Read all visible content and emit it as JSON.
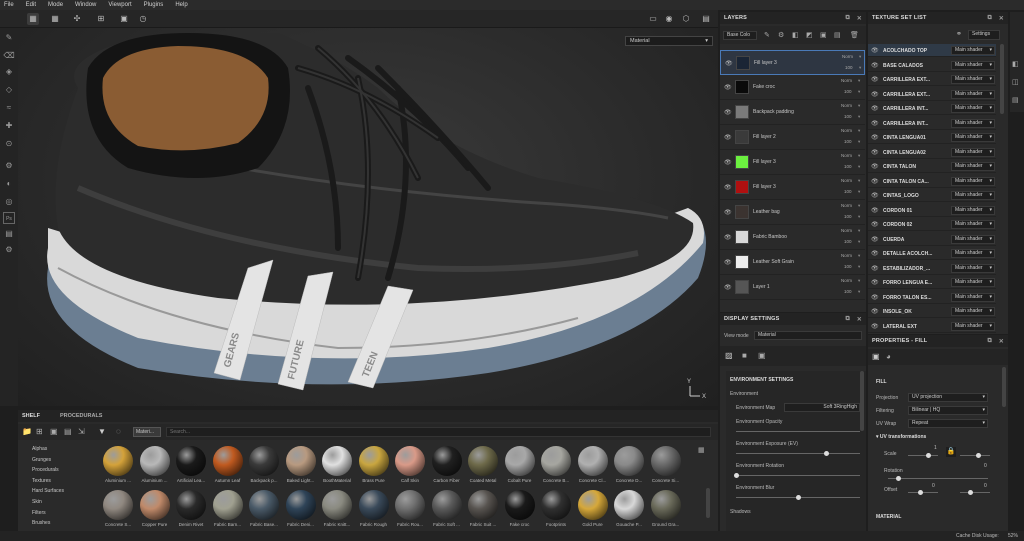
{
  "menu": [
    "File",
    "Edit",
    "Mode",
    "Window",
    "Viewport",
    "Plugins",
    "Help"
  ],
  "viewport": {
    "mode_select": "Material",
    "tag_texts": [
      "GEARS",
      "FUTURE",
      "TEEN"
    ]
  },
  "layers": {
    "title": "LAYERS",
    "channel": "Base Colo",
    "rows": [
      {
        "name": "Fill layer 3",
        "blend": "Norm",
        "opacity": "100",
        "thumb": "#1a2535"
      },
      {
        "name": "Fake croc",
        "blend": "Norm",
        "opacity": "100",
        "thumb": "#0a0a0a"
      },
      {
        "name": "Backpack padding",
        "blend": "Norm",
        "opacity": "100",
        "thumb": "#7a7a7a"
      },
      {
        "name": "Fill layer 2",
        "blend": "Norm",
        "opacity": "100",
        "thumb": "#3a3a3a"
      },
      {
        "name": "Fill layer 3",
        "blend": "Norm",
        "opacity": "100",
        "thumb": "#6cf040"
      },
      {
        "name": "Fill layer 3",
        "blend": "Norm",
        "opacity": "100",
        "thumb": "#b01010"
      },
      {
        "name": "Leather bag",
        "blend": "Norm",
        "opacity": "100",
        "thumb": "#3b3330"
      },
      {
        "name": "Fabric Bamboo",
        "blend": "Norm",
        "opacity": "100",
        "thumb": "#d8d8d8"
      },
      {
        "name": "Leather Soft Grain",
        "blend": "Norm",
        "opacity": "100",
        "thumb": "#eeeeee"
      },
      {
        "name": "Layer 1",
        "blend": "Norm",
        "opacity": "100",
        "thumb": "#555555"
      }
    ]
  },
  "texture_sets": {
    "title": "TEXTURE SET LIST",
    "settings_label": "Settings",
    "rows": [
      {
        "name": "ACOLCHADO TOP",
        "shader": "Main shader"
      },
      {
        "name": "BASE CALADOS",
        "shader": "Main shader"
      },
      {
        "name": "CARRILLERA EXT...",
        "shader": "Main shader"
      },
      {
        "name": "CARRILLERA EXT...",
        "shader": "Main shader"
      },
      {
        "name": "CARRILLERA INT...",
        "shader": "Main shader"
      },
      {
        "name": "CARRILLERA INT...",
        "shader": "Main shader"
      },
      {
        "name": "CINTA LENGUA01",
        "shader": "Main shader"
      },
      {
        "name": "CINTA LENGUA02",
        "shader": "Main shader"
      },
      {
        "name": "CINTA TALON",
        "shader": "Main shader"
      },
      {
        "name": "CINTA TALON CA...",
        "shader": "Main shader"
      },
      {
        "name": "CINTAS_LOGO",
        "shader": "Main shader"
      },
      {
        "name": "CORDON 01",
        "shader": "Main shader"
      },
      {
        "name": "CORDON 02",
        "shader": "Main shader"
      },
      {
        "name": "CUERDA",
        "shader": "Main shader"
      },
      {
        "name": "DETALLE ACOLCH...",
        "shader": "Main shader"
      },
      {
        "name": "ESTABILIZADOR_...",
        "shader": "Main shader"
      },
      {
        "name": "FORRO LENGUA E...",
        "shader": "Main shader"
      },
      {
        "name": "FORRO TALON ES...",
        "shader": "Main shader"
      },
      {
        "name": "INSOLE_OK",
        "shader": "Main shader"
      },
      {
        "name": "LATERAL EXT",
        "shader": "Main shader"
      }
    ]
  },
  "display_settings": {
    "title": "DISPLAY SETTINGS",
    "view_mode_label": "View mode",
    "view_mode": "Material",
    "env_header": "ENVIRONMENT SETTINGS",
    "environment_label": "Environment",
    "env_map_label": "Environment Map",
    "env_map_value": "Soft 3RingHigh",
    "opacity_label": "Environment Opacity",
    "exposure_label": "Environment Exposure (EV)",
    "rotation_label": "Environment Rotation",
    "blur_label": "Environment Blur",
    "shadows_label": "Shadows"
  },
  "properties": {
    "title": "PROPERTIES - FILL",
    "fill_header": "FILL",
    "projection_label": "Projection",
    "projection_value": "UV projection",
    "filtering_label": "Filtering",
    "filtering_value": "Bilinear | HQ",
    "uvwrap_label": "UV Wrap",
    "uvwrap_value": "Repeat",
    "uvtrans_header": "UV transformations",
    "scale_label": "Scale",
    "scale_value": "1",
    "rotation_label": "Rotation",
    "rotation_value": "0",
    "offset_label": "Offset",
    "offset_x": "0",
    "offset_y": "0",
    "material_header": "MATERIAL"
  },
  "shelf": {
    "tabs": [
      "SHELF",
      "PROCEDURALS"
    ],
    "filter_chip": "Materi...",
    "search_placeholder": "Search...",
    "categories": [
      "Alphas",
      "Grunges",
      "Procedurals",
      "Textures",
      "Hard Surfaces",
      "Skin",
      "Filters",
      "Brushes"
    ],
    "row1": [
      {
        "name": "Aluminium ...",
        "color": "#d4a23a"
      },
      {
        "name": "Aluminium ...",
        "color": "#b8b8b8"
      },
      {
        "name": "Artificial Lea...",
        "color": "#1a1a1a"
      },
      {
        "name": "Autumn Leaf",
        "color": "#c05a20"
      },
      {
        "name": "Backpack p...",
        "color": "#3a3a3a"
      },
      {
        "name": "Baked Light...",
        "color": "#b89a80"
      },
      {
        "name": "BoothMaterial",
        "color": "#e0e0e0"
      },
      {
        "name": "Brass Pure",
        "color": "#c9a640"
      },
      {
        "name": "Calf Skin",
        "color": "#d99a88"
      },
      {
        "name": "Carbon Fiber",
        "color": "#202020"
      },
      {
        "name": "Coated Metal",
        "color": "#6e6a4a"
      },
      {
        "name": "Cobalt Pure",
        "color": "#a8a8a8"
      },
      {
        "name": "Concrete B...",
        "color": "#a6a6a0"
      },
      {
        "name": "Concrete Cl...",
        "color": "#b0b0b0"
      },
      {
        "name": "Concrete D...",
        "color": "#8a8a8a"
      },
      {
        "name": "Concrete Si...",
        "color": "#6a6a6a"
      }
    ],
    "row2": [
      {
        "name": "Concrete S...",
        "color": "#908880"
      },
      {
        "name": "Copper Pure",
        "color": "#c08a6a"
      },
      {
        "name": "Denim Rivet",
        "color": "#2a2a2a"
      },
      {
        "name": "Fabric Barn...",
        "color": "#a0a090"
      },
      {
        "name": "Fabric Base...",
        "color": "#4a5a68"
      },
      {
        "name": "Fabric Deni...",
        "color": "#2f4458"
      },
      {
        "name": "Fabric Knitt...",
        "color": "#8a8a80"
      },
      {
        "name": "Fabric Rough",
        "color": "#3a4a5a"
      },
      {
        "name": "Fabric Rou...",
        "color": "#707070"
      },
      {
        "name": "Fabric Soft ...",
        "color": "#5a5a5a"
      },
      {
        "name": "Fabric Suit ...",
        "color": "#585450"
      },
      {
        "name": "Fake croc",
        "color": "#1a1a1a"
      },
      {
        "name": "Footprints",
        "color": "#303030"
      },
      {
        "name": "Gold Pure",
        "color": "#d6a83a"
      },
      {
        "name": "Gouache P...",
        "color": "#d8d8d8"
      },
      {
        "name": "Ground Gra...",
        "color": "#6a6a5a"
      }
    ]
  },
  "status": {
    "cache_label": "Cache Disk Usage:",
    "cache_value": "52%"
  }
}
